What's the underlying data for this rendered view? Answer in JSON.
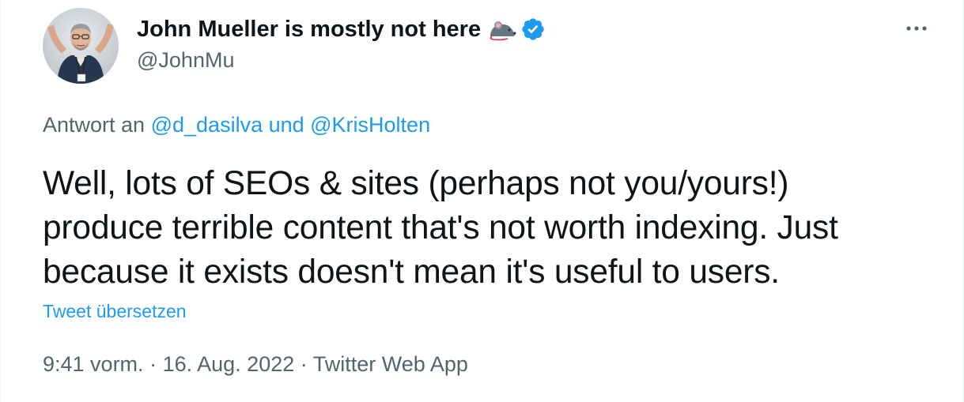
{
  "author": {
    "display_name": "John Mueller is mostly not here",
    "handle": "@JohnMu",
    "name_emoji": "rat-emoji",
    "verified_icon": "verified-badge-icon",
    "verified_color": "#1d9bf0"
  },
  "menu": {
    "icon": "more-options-icon"
  },
  "reply": {
    "prefix": "Antwort an",
    "mentions": "@d_dasilva und @KrisHolten"
  },
  "tweet": {
    "lines": [
      "Well, lots of SEOs & sites (perhaps not you/yours!)",
      "produce terrible content that's not worth indexing. Just",
      "because it exists doesn't mean it's useful to users."
    ],
    "translate_label": "Tweet übersetzen"
  },
  "meta": {
    "time": "9:41 vorm.",
    "separator": "·",
    "date": "16. Aug. 2022",
    "source": "Twitter Web App"
  },
  "colors": {
    "primary_text": "#0f1419",
    "secondary_text": "#536471",
    "link": "#1d9bf0"
  }
}
